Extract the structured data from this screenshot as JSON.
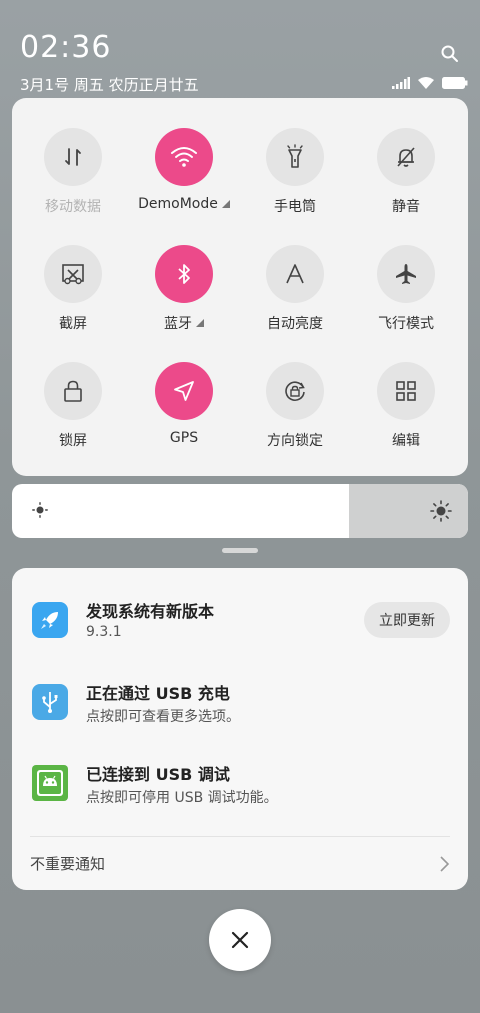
{
  "status": {
    "time": "02:36",
    "date": "3月1号 周五 农历正月廿五"
  },
  "quick_settings": {
    "accent_color": "#ec4a8a",
    "tiles": [
      {
        "label": "移动数据",
        "icon": "mobile-data-icon",
        "active": false,
        "muted": true
      },
      {
        "label": "DemoMode",
        "icon": "wifi-icon",
        "active": true,
        "expandable": true
      },
      {
        "label": "手电筒",
        "icon": "flashlight-icon",
        "active": false
      },
      {
        "label": "静音",
        "icon": "bell-off-icon",
        "active": false
      },
      {
        "label": "截屏",
        "icon": "screenshot-icon",
        "active": false
      },
      {
        "label": "蓝牙",
        "icon": "bluetooth-icon",
        "active": true,
        "expandable": true
      },
      {
        "label": "自动亮度",
        "icon": "auto-brightness-icon",
        "active": false
      },
      {
        "label": "飞行模式",
        "icon": "airplane-icon",
        "active": false
      },
      {
        "label": "锁屏",
        "icon": "lock-icon",
        "active": false
      },
      {
        "label": "GPS",
        "icon": "location-arrow-icon",
        "active": true
      },
      {
        "label": "方向锁定",
        "icon": "rotation-lock-icon",
        "active": false
      },
      {
        "label": "编辑",
        "icon": "grid-edit-icon",
        "active": false
      }
    ]
  },
  "brightness": {
    "level": 0.74
  },
  "notifications": {
    "items": [
      {
        "title": "发现系统有新版本",
        "subtitle": "9.3.1",
        "icon": "rocket-icon",
        "icon_bg": "#3aa6f0",
        "action": "立即更新"
      },
      {
        "title": "正在通过 USB 充电",
        "subtitle": "点按即可查看更多选项。",
        "icon": "usb-icon",
        "icon_bg": "#4aa9e6"
      },
      {
        "title": "已连接到 USB 调试",
        "subtitle": "点按即可停用 USB 调试功能。",
        "icon": "android-icon",
        "icon_bg": "#5bb545"
      }
    ],
    "footer": "不重要通知"
  }
}
